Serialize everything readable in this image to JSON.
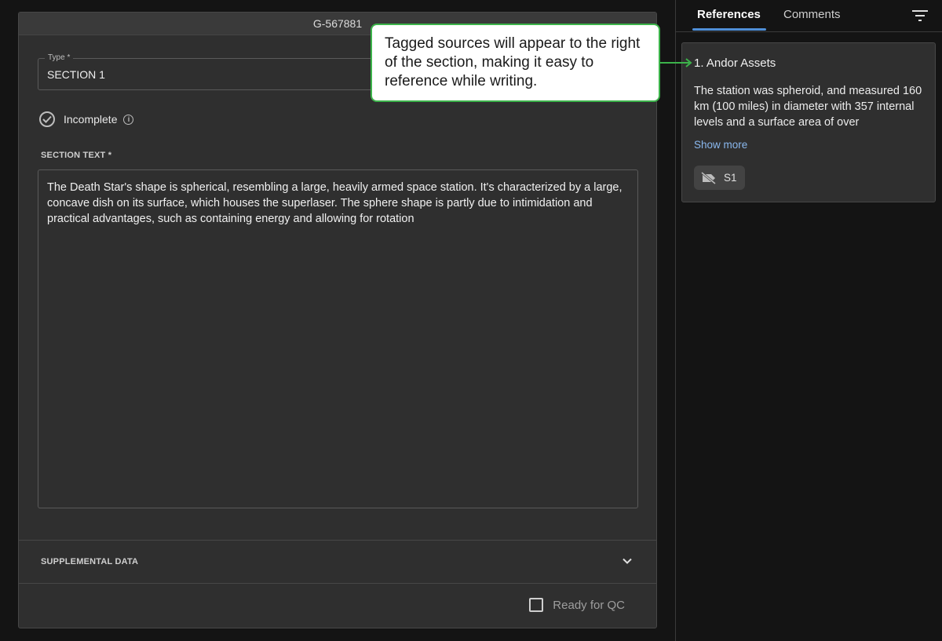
{
  "editor": {
    "record_id": "G-567881",
    "type_label": "Type *",
    "type_value": "SECTION 1",
    "status": "Incomplete",
    "section_text_label": "SECTION TEXT *",
    "section_text": "The Death Star's shape is spherical, resembling a large, heavily armed space station. It's characterized by a large, concave dish on its surface, which houses the superlaser. The sphere shape is partly due to intimidation and practical advantages, such as containing energy and allowing for rotation",
    "supplemental_label": "SUPPLEMENTAL DATA",
    "qc_label": "Ready for QC"
  },
  "panel": {
    "tabs": [
      {
        "label": "References",
        "active": true
      },
      {
        "label": "Comments",
        "active": false
      }
    ],
    "references": [
      {
        "title": "1. Andor Assets",
        "body": "The station was spheroid, and measured 160 km (100 miles) in diameter with 357 internal levels and a surface area of over",
        "show_more": "Show more",
        "chip": "S1"
      }
    ]
  },
  "callout": {
    "text": "Tagged sources will appear to the right of the section, making it easy to reference while writing."
  },
  "colors": {
    "accent": "#4f8fd8",
    "link": "#8ab8ee",
    "callout_border": "#3cb34a"
  }
}
